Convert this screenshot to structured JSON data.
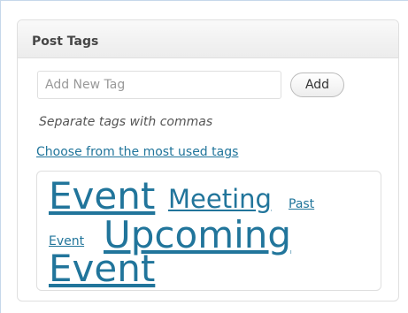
{
  "postbox": {
    "title": "Post Tags",
    "input": {
      "value": "",
      "placeholder": "Add New Tag"
    },
    "add_label": "Add",
    "hint": "Separate tags with commas",
    "choose_link": "Choose from the most used tags"
  },
  "tagcloud": {
    "tags": [
      {
        "label": "Event"
      },
      {
        "label": "Meeting"
      },
      {
        "label_line1": "Past",
        "label_line2": "Event"
      },
      {
        "label_line1": "Upcoming",
        "label_line2": "Event"
      }
    ]
  },
  "colors": {
    "link": "#21759b",
    "header_text": "#464646",
    "border": "#dfdfdf"
  }
}
